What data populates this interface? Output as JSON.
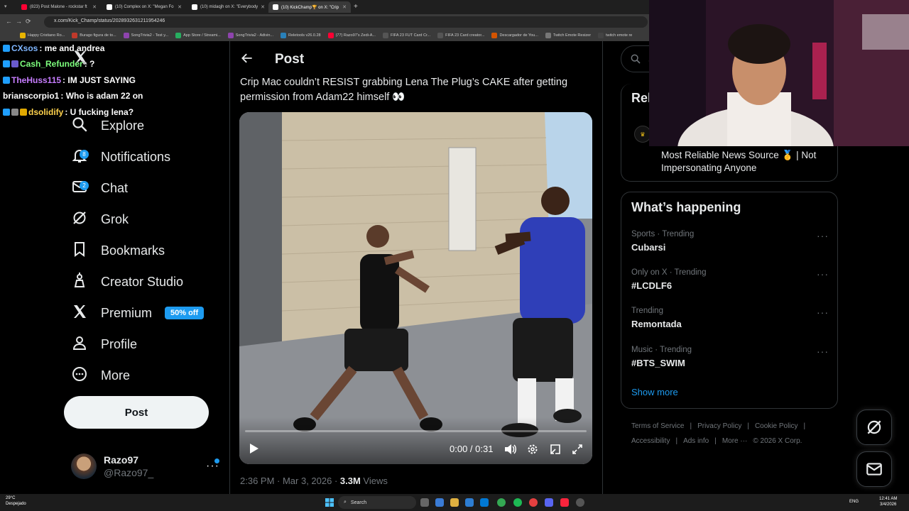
{
  "browser": {
    "tabs": [
      {
        "label": "(823) Post Malone - rockstar ft",
        "color": "#ff0033"
      },
      {
        "label": "(10) Complex on X: \"Megan Fo",
        "color": "#ffffff"
      },
      {
        "label": "(10) midaqjh on X: \"Everybody",
        "color": "#ffffff"
      },
      {
        "label": "(10) KickChamp🏆 on X: \"Crip",
        "color": "#ffffff"
      }
    ],
    "new_tab": "+",
    "url": "x.com/Kick_Champ/status/2028932631211954246",
    "bookmarks": [
      "Happy Cristiano Ro...",
      "Burago figura de to...",
      "SongTrivia2 - Test y...",
      "App Store / Streami...",
      "SongTrivia2 - Adivin...",
      "Reletools v26.0.28",
      "(77) Razo97's Zedi-A...",
      "FIFA 23 FUT Card Cr...",
      "FIFA 23 Card creator...",
      "Descargador de You...",
      "Twitch Emote Resizer",
      "twitch emote re"
    ]
  },
  "chat": [
    {
      "user": "CXsos",
      "message": ": me and andrea",
      "color": "#7fb6ff"
    },
    {
      "user": "Cash_Refunder",
      "message": ": ?",
      "color": "#7dff7d"
    },
    {
      "user": "TheHuss115",
      "message": ": IM JUST SAYING",
      "color": "#c77dff"
    },
    {
      "user": "brianscorpio1",
      "message": ": Who is adam 22 on",
      "color": "#ffffff"
    },
    {
      "user": "dsolidify",
      "message": ": U fucking lena?",
      "color": "#ffd24d"
    }
  ],
  "nav": {
    "items": [
      {
        "label": "Explore",
        "icon": "search-icon",
        "badge": ""
      },
      {
        "label": "Notifications",
        "icon": "bell-icon",
        "badge": "8"
      },
      {
        "label": "Chat",
        "icon": "mail-icon",
        "badge": "2"
      },
      {
        "label": "Grok",
        "icon": "grok-icon",
        "badge": ""
      },
      {
        "label": "Bookmarks",
        "icon": "bookmark-icon",
        "badge": ""
      },
      {
        "label": "Creator Studio",
        "icon": "creator-icon",
        "badge": ""
      },
      {
        "label": "Premium",
        "icon": "x-logo-icon",
        "badge": ""
      },
      {
        "label": "Profile",
        "icon": "person-icon",
        "badge": ""
      },
      {
        "label": "More",
        "icon": "more-circle-icon",
        "badge": ""
      }
    ],
    "premium_offer": "50% off",
    "post_label": "Post",
    "user_name": "Razo97",
    "user_handle": "@Razo97_",
    "user_more": "···"
  },
  "post": {
    "header": "Post",
    "text": "Crip Mac couldn’t RESIST grabbing Lena The Plug’s CAKE after getting permission from Adam22 himself 👀",
    "video_time": "0:00 / 0:31",
    "video_progress": 0.0,
    "timestamp": "2:36 PM · Mar 3, 2026 · ",
    "views_count": "3.3M",
    "views_label": " Views"
  },
  "right": {
    "search_placeholder": "Se",
    "relevant_title": "Rel",
    "relevant_bio": "Most Reliable News Source 🥇 | Not Impersonating Anyone",
    "happening_title": "What’s happening",
    "trends": [
      {
        "meta": "Sports · Trending",
        "name": "Cubarsi"
      },
      {
        "meta": "Only on X · Trending",
        "name": "#LCDLF6"
      },
      {
        "meta": "Trending",
        "name": "Remontada"
      },
      {
        "meta": "Music · Trending",
        "name": "#BTS_SWIM"
      }
    ],
    "trend_more": "···",
    "show_more": "Show more",
    "footer": {
      "row1": [
        "Terms of Service",
        "Privacy Policy",
        "Cookie Policy"
      ],
      "row2": [
        "Accessibility",
        "Ads info",
        "More ···",
        "© 2026 X Corp."
      ]
    }
  },
  "taskbar": {
    "search": "Search",
    "weather_temp": "29°C",
    "weather_text": "Despejado",
    "lang": "ENG",
    "time": "12:41 AM",
    "date": "3/4/2026"
  },
  "colors": {
    "accent": "#1d9bf0",
    "background": "#000000",
    "text": "#e7e9ea",
    "muted": "#71767b"
  }
}
